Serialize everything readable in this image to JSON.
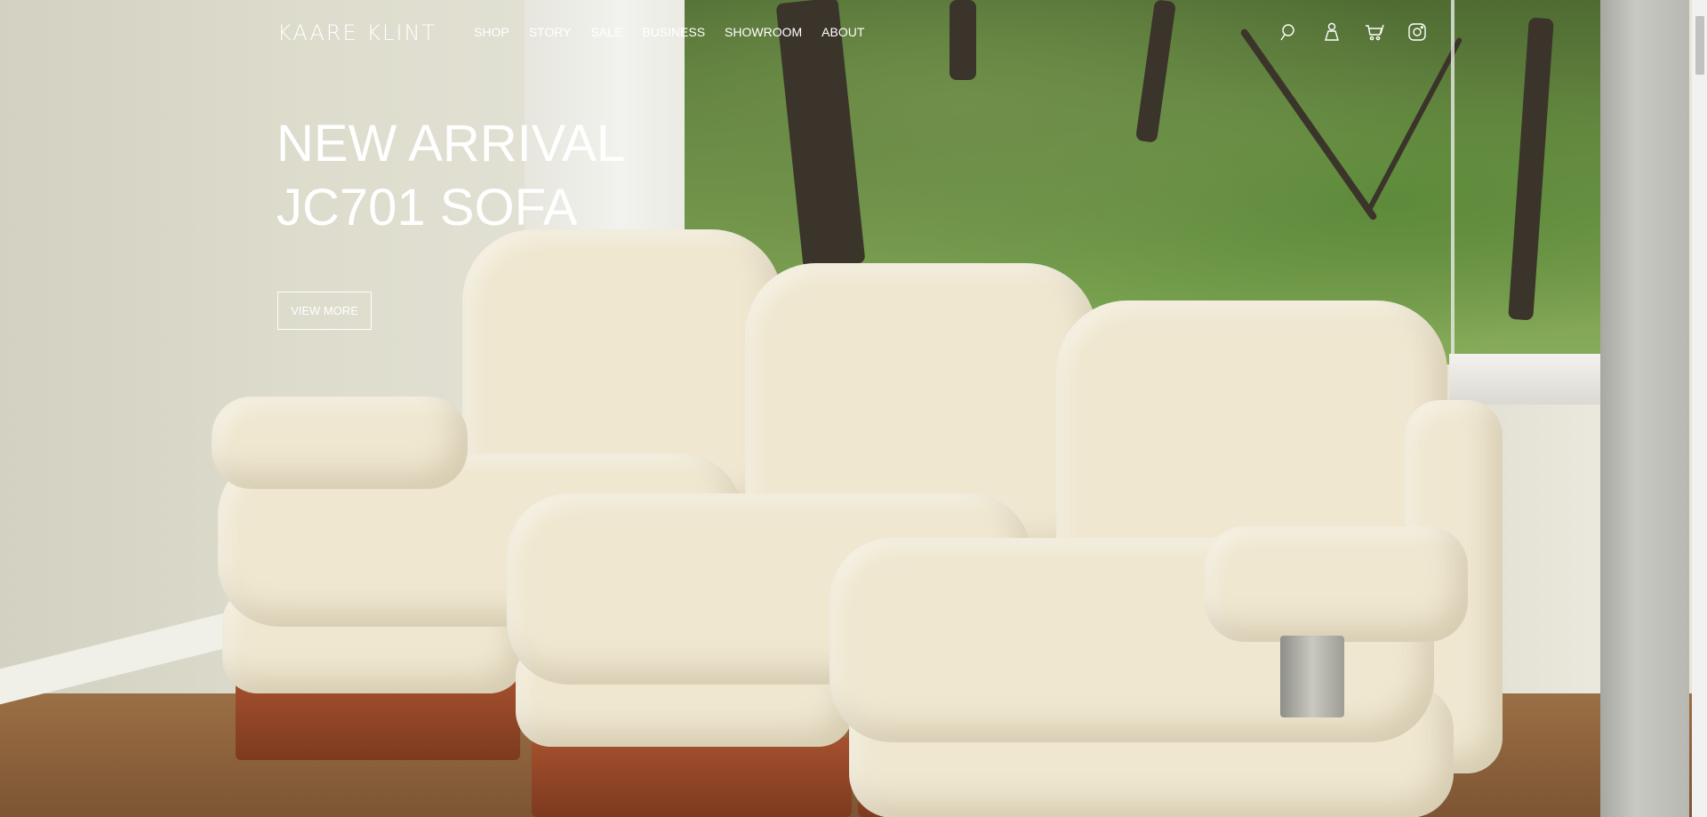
{
  "header": {
    "logo": "KAARE KLINT",
    "nav": [
      {
        "label": "SHOP"
      },
      {
        "label": "STORY"
      },
      {
        "label": "SALE"
      },
      {
        "label": "BUSINESS"
      },
      {
        "label": "SHOWROOM"
      },
      {
        "label": "ABOUT"
      }
    ],
    "icons": [
      "search-icon",
      "account-icon",
      "cart-icon",
      "instagram-icon"
    ]
  },
  "hero": {
    "title_line1": "NEW ARRIVAL",
    "title_line2": "JC701 SOFA",
    "cta_label": "VIEW MORE"
  },
  "colors": {
    "text": "#ffffff",
    "sofa": "#efe7d0",
    "wood": "#9b6f45"
  }
}
